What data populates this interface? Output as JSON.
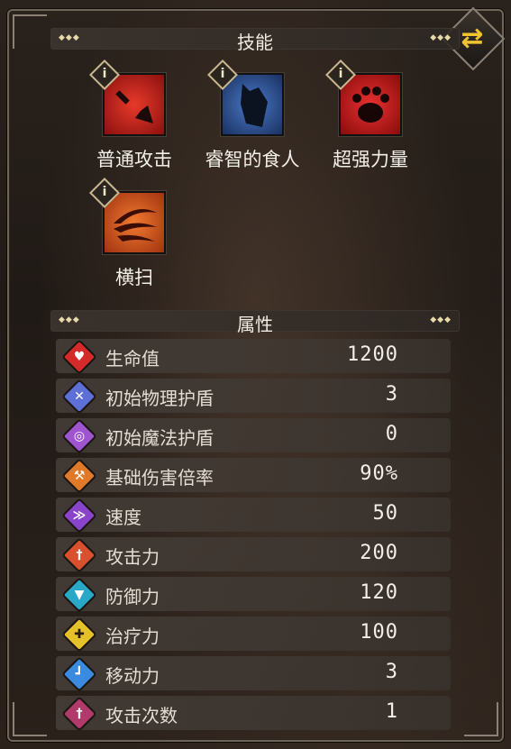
{
  "skills_section": {
    "title": "技能"
  },
  "skills": [
    {
      "label": "普通攻击",
      "icon": "sword-icon",
      "bg": "#c0201a"
    },
    {
      "label": "睿智的食人",
      "icon": "shadow-figure-icon",
      "bg": "#2e5aa0"
    },
    {
      "label": "超强力量",
      "icon": "paw-icon",
      "bg": "#c81818"
    },
    {
      "label": "横扫",
      "icon": "sweep-slash-icon",
      "bg": "#e05a1e"
    }
  ],
  "attributes_section": {
    "title": "属性"
  },
  "attributes": [
    {
      "label": "生命值",
      "value": "1200",
      "icon": "heart-icon",
      "color": "#d42a2a",
      "glyph": "♥"
    },
    {
      "label": "初始物理护盾",
      "value": "3",
      "icon": "physical-shield-icon",
      "color": "#5f6fd8",
      "glyph": "✕"
    },
    {
      "label": "初始魔法护盾",
      "value": "0",
      "icon": "magic-shield-icon",
      "color": "#a055d0",
      "glyph": "◎"
    },
    {
      "label": "基础伤害倍率",
      "value": "90%",
      "icon": "axe-icon",
      "color": "#e07a28",
      "glyph": "⚒"
    },
    {
      "label": "速度",
      "value": "50",
      "icon": "wing-icon",
      "color": "#8a44cc",
      "glyph": "≫"
    },
    {
      "label": "攻击力",
      "value": "200",
      "icon": "sword-icon",
      "color": "#d8502e",
      "glyph": "†"
    },
    {
      "label": "防御力",
      "value": "120",
      "icon": "armor-icon",
      "color": "#29a8c8",
      "glyph": "▼"
    },
    {
      "label": "治疗力",
      "value": "100",
      "icon": "heal-cross-icon",
      "color": "#e6c22a",
      "glyph": "✚"
    },
    {
      "label": "移动力",
      "value": "3",
      "icon": "boot-icon",
      "color": "#3a8ae0",
      "glyph": "┛"
    },
    {
      "label": "攻击次数",
      "value": "1",
      "icon": "dagger-icon",
      "color": "#b03a6a",
      "glyph": "†"
    }
  ],
  "colors": {
    "accent": "#f0c431",
    "frame": "#6e6458"
  },
  "refresh_icon": "refresh-swap-icon"
}
